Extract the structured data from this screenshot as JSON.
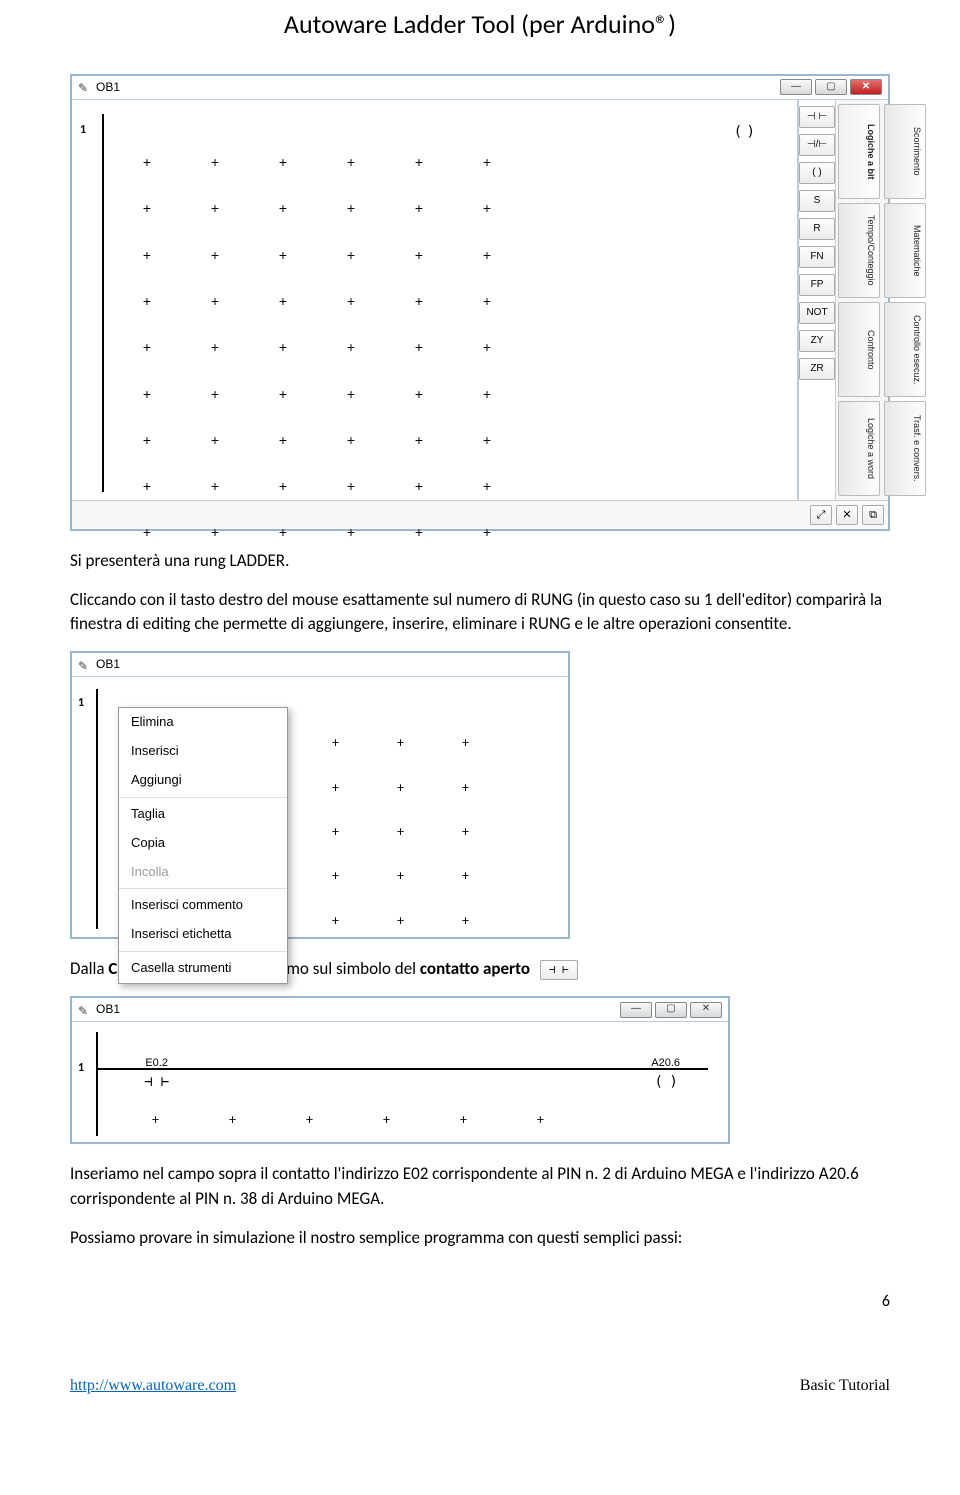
{
  "header": {
    "title": "Autoware Ladder Tool (per Arduino®)"
  },
  "ob1": {
    "title": "OB1",
    "row_num": "1",
    "output_symbol": "( )"
  },
  "toolbox": {
    "symbols": [
      "⊣ ⊢",
      "⊣/⊢",
      "( )",
      "S",
      "R",
      "FN",
      "FP",
      "NOT",
      "ZY",
      "ZR"
    ],
    "tabs_col1": [
      "Logiche a bit",
      "Tempo/Conteggio",
      "Confronto",
      "Logiche a word"
    ],
    "tabs_col2": [
      "Scorrimento",
      "Matematiche",
      "Controllo esecuz.",
      "Trasf. e convers."
    ],
    "bottom": [
      "⤢",
      "✕",
      "⧉"
    ]
  },
  "para1": "Si presenterà una rung LADDER.",
  "para2": "Cliccando con il tasto destro del mouse esattamente sul numero di RUNG (in questo caso su 1 dell'editor) comparirà la finestra di editing che permette di aggiungere, inserire, eliminare i RUNG  e le altre operazioni consentite.",
  "context_menu": {
    "items": [
      "Elimina",
      "Inserisci",
      "Aggiungi"
    ],
    "items2": [
      "Taglia",
      "Copia",
      "Incolla"
    ],
    "items3": [
      "Inserisci commento",
      "Inserisci etichetta"
    ],
    "items4": [
      "Casella strumenti"
    ]
  },
  "para3_pre": "Dalla ",
  "para3_b1": "Casella Strumenti",
  "para3_mid": " clicchiamo sul simbolo del ",
  "para3_b2": "contatto aperto",
  "contact_icon": "⊣ ⊢",
  "rung": {
    "contact_label": "E0.2",
    "contact_symbol": "⊣ ⊢",
    "coil_label": "A20.6",
    "coil_symbol": "( )"
  },
  "para4": "Inseriamo nel campo sopra il contatto l'indirizzo E02 corrispondente al PIN n. 2 di Arduino MEGA e l'indirizzo A20.6 corrispondente al PIN n. 38 di Arduino MEGA.",
  "para5": "Possiamo provare in simulazione il nostro semplice programma con questi semplici passi:",
  "footer": {
    "link": "http://www.autoware.com",
    "right": "Basic Tutorial",
    "page": "6"
  }
}
